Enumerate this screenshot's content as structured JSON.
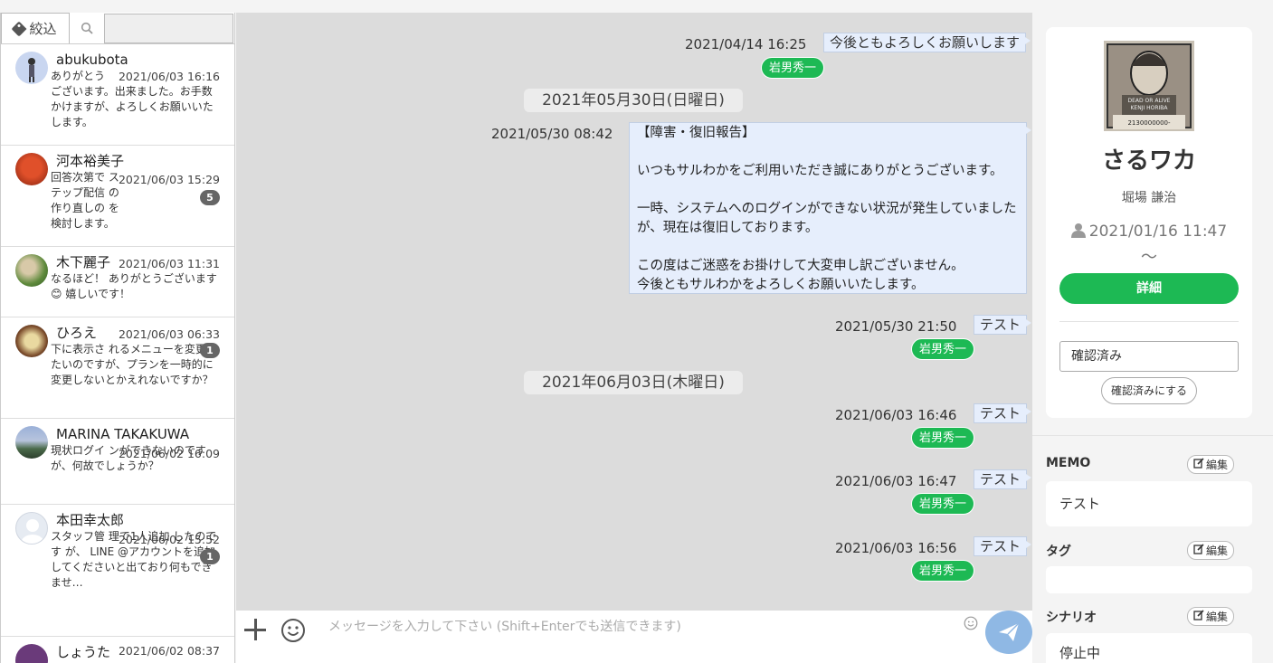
{
  "sidebar": {
    "filter_label": "絞込",
    "search_placeholder": "",
    "contacts": [
      {
        "name": "abukubota",
        "time": "2021/06/03 16:16",
        "message": "ありがとう　　　　　　　　　　　　ございます。出来ました。お手数かけますが、よろしくお願いいたします。",
        "badge": ""
      },
      {
        "name": "河本裕美子",
        "time": "2021/06/03 15:29",
        "message": "回答次第で ステップ配信 の作り直しの を検討します。",
        "badge": "5"
      },
      {
        "name": "木下麗子",
        "time": "2021/06/03 11:31",
        "message": "なるほど！ ありがとうございます😊 嬉しいです！",
        "badge": ""
      },
      {
        "name": "ひろえ",
        "time": "2021/06/03 06:33",
        "message": "下に表示さ れるメニューを変更したいのですが、プランを一時的に変更しないとかえれないですか？",
        "badge": "1"
      },
      {
        "name": "MARINA TAKAKUWA",
        "time": "2021/06/02 16:09",
        "message": "現状ログイ ンができないのですが、何故でしょうか？",
        "badge": ""
      },
      {
        "name": "本田幸太郎",
        "time": "2021/06/02 15:52",
        "message": "スタッフ管 理で1人追加 したのです が、 LINE @アカウントを追加してくださいと出ており何もできませ…",
        "badge": "1"
      },
      {
        "name": "しょうた",
        "time": "2021/06/02 08:37",
        "message": "",
        "badge": ""
      }
    ]
  },
  "chat": {
    "messages": [
      {
        "time": "2021/04/14 16:25",
        "text": "今後ともよろしくお願いします",
        "sender": "岩男秀一"
      },
      {
        "date": "2021年05月30日(日曜日)"
      },
      {
        "time": "2021/05/30 08:42",
        "text": "【障害・復旧報告】\n\nいつもサルわかをご利用いただき誠にありがとうございます。\n\n一時、システムへのログインができない状況が発生していましたが、現在は復旧しております。\n\nこの度はご迷惑をお掛けして大変申し訳ございません。\n今後ともサルわかをよろしくお願いいたします。"
      },
      {
        "time": "2021/05/30 21:50",
        "text": "テスト",
        "sender": "岩男秀一"
      },
      {
        "date": "2021年06月03日(木曜日)"
      },
      {
        "time": "2021/06/03 16:46",
        "text": "テスト",
        "sender": "岩男秀一"
      },
      {
        "time": "2021/06/03 16:47",
        "text": "テスト",
        "sender": "岩男秀一"
      },
      {
        "time": "2021/06/03 16:56",
        "text": "テスト",
        "sender": "岩男秀一"
      }
    ],
    "input_placeholder": "メッセージを入力して下さい (Shift+Enterでも送信できます)"
  },
  "profile": {
    "name": "さるワカ",
    "sub_name": "堀場 謙治",
    "registered": "2021/01/16 11:47",
    "tilde": "〜",
    "detail_button": "詳細",
    "status_value": "確認済み",
    "confirm_button": "確認済みにする",
    "image_caption_line1": "DEAD OR ALIVE",
    "image_caption_line2": "KENJI HORIBA",
    "image_caption_line3": "2130000000-"
  },
  "sections": {
    "memo": {
      "title": "MEMO",
      "edit": "編集",
      "content": "テスト"
    },
    "tag": {
      "title": "タグ",
      "edit": "編集",
      "content": ""
    },
    "scenario": {
      "title": "シナリオ",
      "edit": "編集",
      "content": "停止中"
    }
  },
  "colors": {
    "accent_green": "#1db954",
    "send_blue": "#8fb8e4",
    "bubble": "#e6eefc",
    "chat_bg": "#dcdcdc"
  }
}
